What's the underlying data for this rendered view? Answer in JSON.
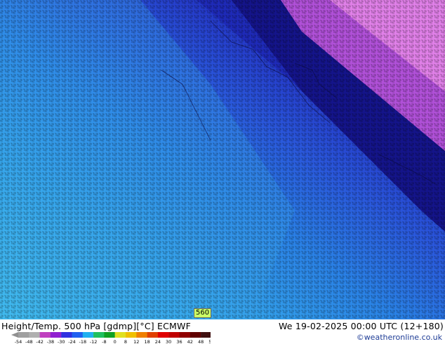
{
  "map": {
    "contour_label": "560"
  },
  "footer": {
    "title": "Height/Temp. 500 hPa [gdmp][°C] ECMWF",
    "valid_time": "We 19-02-2025 00:00 UTC (12+180)",
    "credit": "©weatheronline.co.uk"
  },
  "legend": {
    "ticks": [
      "-54",
      "-48",
      "-42",
      "-38",
      "-30",
      "-24",
      "-18",
      "-12",
      "-8",
      "0",
      "8",
      "12",
      "18",
      "24",
      "30",
      "36",
      "42",
      "48",
      "54"
    ],
    "colors": [
      "#a0a0a0",
      "#b0b0b0",
      "#c040c0",
      "#9020d0",
      "#3030e0",
      "#2060f0",
      "#20b0f0",
      "#20c060",
      "#10a020",
      "#e0e020",
      "#f0c000",
      "#f08000",
      "#e04000",
      "#e00000",
      "#c00000",
      "#900000",
      "#600000",
      "#401010"
    ]
  },
  "colors": {
    "land_light_blue": "#3ab4e6",
    "mid_blue": "#2a82e6",
    "deep_blue": "#2a4ad2",
    "navy_band": "#14148a",
    "violet": "#b050d8",
    "magenta": "#e080e8"
  }
}
